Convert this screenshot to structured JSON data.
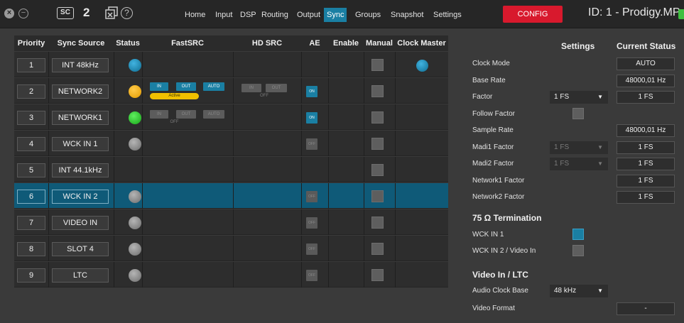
{
  "topbar": {
    "close_glyph": "×",
    "minimize_glyph": "−",
    "sc_label": "SC",
    "number": "2",
    "help_glyph": "?",
    "nav": [
      "Home",
      "Input",
      "DSP",
      "Routing",
      "Output",
      "Sync",
      "Groups",
      "Snapshot",
      "Settings"
    ],
    "active_nav": "Sync",
    "config_label": "CONFIG",
    "device_id": "ID: 1 - Prodigy.MP",
    "colors": {
      "active": "#1a7fa3",
      "config": "#d8192d"
    }
  },
  "matrix": {
    "headers": [
      "Priority",
      "Sync Source",
      "Status",
      "FastSRC",
      "HD SRC",
      "AE",
      "Enable",
      "Manual",
      "Clock Master"
    ],
    "rows": [
      {
        "priority": "1",
        "source": "INT 48kHz",
        "status": "blue",
        "fastsrc": null,
        "hdsrc": null,
        "ae": null,
        "master": true
      },
      {
        "priority": "2",
        "source": "NETWORK2",
        "status": "orange",
        "fastsrc": {
          "in": "IN",
          "out": "OUT",
          "auto": "AUTO",
          "state": "active",
          "badge": "Active"
        },
        "hdsrc": {
          "in": "IN",
          "out": "OUT",
          "sub": "OFF"
        },
        "ae": "ON",
        "master": false
      },
      {
        "priority": "3",
        "source": "NETWORK1",
        "status": "green",
        "fastsrc": {
          "in": "IN",
          "out": "OUT",
          "auto": "AUTO",
          "state": "off",
          "sub": "OFF"
        },
        "hdsrc": null,
        "ae": "ON",
        "master": false
      },
      {
        "priority": "4",
        "source": "WCK IN 1",
        "status": "grey",
        "fastsrc": null,
        "hdsrc": null,
        "ae": "OFF",
        "master": false
      },
      {
        "priority": "5",
        "source": "INT 44.1kHz",
        "status": null,
        "fastsrc": null,
        "hdsrc": null,
        "ae": null,
        "master": false
      },
      {
        "priority": "6",
        "source": "WCK IN 2",
        "status": "grey",
        "fastsrc": null,
        "hdsrc": null,
        "ae": "OFF",
        "master": false,
        "selected": true
      },
      {
        "priority": "7",
        "source": "VIDEO IN",
        "status": "grey",
        "fastsrc": null,
        "hdsrc": null,
        "ae": "OFF",
        "master": false
      },
      {
        "priority": "8",
        "source": "SLOT 4",
        "status": "grey",
        "fastsrc": null,
        "hdsrc": null,
        "ae": "OFF",
        "master": false
      },
      {
        "priority": "9",
        "source": "LTC",
        "status": "grey",
        "fastsrc": null,
        "hdsrc": null,
        "ae": "OFF",
        "master": false
      }
    ]
  },
  "settings": {
    "settings_header": "Settings",
    "status_header": "Current Status",
    "rows": [
      {
        "label": "Clock Mode",
        "dropdown": null,
        "status": "AUTO"
      },
      {
        "label": "Base Rate",
        "dropdown": null,
        "status": "48000,01 Hz"
      },
      {
        "label": "Factor",
        "dropdown": "1 FS",
        "status": "1 FS"
      },
      {
        "label": "Follow Factor",
        "toggle": "off",
        "status": null
      },
      {
        "label": "Sample Rate",
        "dropdown": null,
        "status": "48000,01 Hz"
      },
      {
        "label": "Madi1 Factor",
        "dropdown": "1 FS",
        "dropdown_disabled": true,
        "status": "1 FS"
      },
      {
        "label": "Madi2 Factor",
        "dropdown": "1 FS",
        "dropdown_disabled": true,
        "status": "1 FS"
      },
      {
        "label": "Network1 Factor",
        "dropdown": null,
        "status": "1 FS"
      },
      {
        "label": "Network2 Factor",
        "dropdown": null,
        "status": "1 FS"
      }
    ],
    "termination_header": "75 Ω Termination",
    "termination": [
      {
        "label": "WCK IN 1",
        "on": true
      },
      {
        "label": "WCK IN 2 / Video In",
        "on": false
      }
    ],
    "video_header": "Video In / LTC",
    "audio_clock_base_label": "Audio Clock Base",
    "audio_clock_base_value": "48 kHz",
    "video_format_label": "Video Format",
    "video_format_status": "-"
  }
}
